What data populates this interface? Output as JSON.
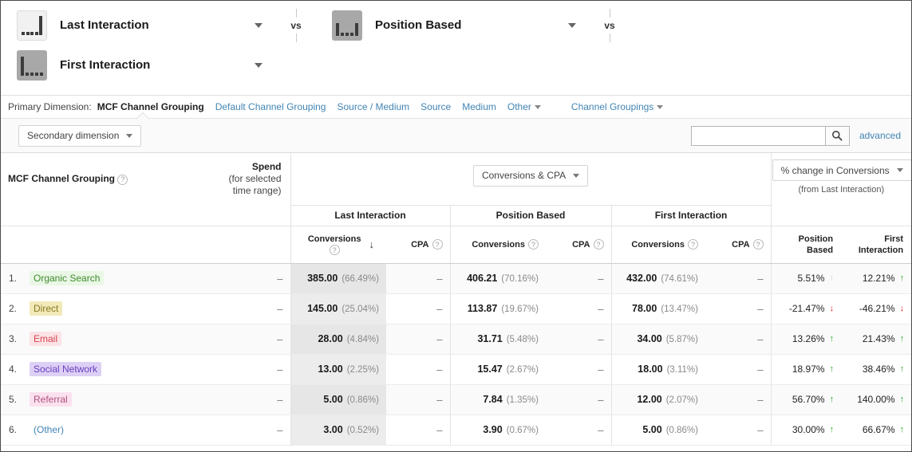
{
  "models": {
    "separator_label": "vs",
    "slots": [
      {
        "name": "Last Interaction",
        "icon": "bars-last-interaction-icon",
        "icon_style": "light",
        "bars": [
          4,
          4,
          4,
          4,
          24
        ]
      },
      {
        "name": "Position Based",
        "icon": "bars-position-based-icon",
        "icon_style": "gray",
        "bars": [
          16,
          4,
          4,
          4,
          16
        ]
      },
      {
        "name": "First Interaction",
        "icon": "bars-first-interaction-icon",
        "icon_style": "gray",
        "bars": [
          24,
          4,
          4,
          4,
          4
        ]
      }
    ]
  },
  "primary_dimension": {
    "label": "Primary Dimension:",
    "items": [
      {
        "label": "MCF Channel Grouping",
        "active": true,
        "caret": false
      },
      {
        "label": "Default Channel Grouping",
        "active": false,
        "caret": false
      },
      {
        "label": "Source / Medium",
        "active": false,
        "caret": false
      },
      {
        "label": "Source",
        "active": false,
        "caret": false
      },
      {
        "label": "Medium",
        "active": false,
        "caret": false
      },
      {
        "label": "Other",
        "active": false,
        "caret": true
      },
      {
        "label": "Channel Groupings",
        "active": false,
        "caret": true
      }
    ]
  },
  "toolbar": {
    "secondary_dimension_label": "Secondary dimension",
    "search_value": "",
    "search_placeholder": "",
    "advanced_label": "advanced",
    "search_icon": "magnifier-icon"
  },
  "table": {
    "dimension_header": "MCF Channel Grouping",
    "spend_header_line1": "Spend",
    "spend_header_line2": "(for selected",
    "spend_header_line3": "time range)",
    "metric_selector": "Conversions & CPA",
    "change_selector": "% change in Conversions",
    "change_sublabel": "(from Last Interaction)",
    "sort_arrow": "↓",
    "help_glyph": "?",
    "model_columns": [
      {
        "name": "Last Interaction",
        "metrics": [
          "Conversions",
          "CPA"
        ],
        "sorted_metric": "Conversions"
      },
      {
        "name": "Position Based",
        "metrics": [
          "Conversions",
          "CPA"
        ],
        "sorted_metric": ""
      },
      {
        "name": "First Interaction",
        "metrics": [
          "Conversions",
          "CPA"
        ],
        "sorted_metric": ""
      }
    ],
    "change_columns": [
      {
        "line1": "Position",
        "line2": "Based"
      },
      {
        "line1": "First",
        "line2": "Interaction"
      }
    ],
    "rows": [
      {
        "index": "1.",
        "channel": "Organic Search",
        "chip_bg": "#eaf7e6",
        "chip_fg": "#3f8a2e",
        "spend": "–",
        "last_conv": "385.00",
        "last_conv_pct": "(66.49%)",
        "last_cpa": "–",
        "pos_conv": "406.21",
        "pos_conv_pct": "(70.16%)",
        "pos_cpa": "–",
        "first_conv": "432.00",
        "first_conv_pct": "(74.61%)",
        "first_cpa": "–",
        "chg_pos": "5.51%",
        "chg_pos_dir": "flat",
        "chg_first": "12.21%",
        "chg_first_dir": "up"
      },
      {
        "index": "2.",
        "channel": "Direct",
        "chip_bg": "#f2e9b8",
        "chip_fg": "#8a7a21",
        "spend": "–",
        "last_conv": "145.00",
        "last_conv_pct": "(25.04%)",
        "last_cpa": "–",
        "pos_conv": "113.87",
        "pos_conv_pct": "(19.67%)",
        "pos_cpa": "–",
        "first_conv": "78.00",
        "first_conv_pct": "(13.47%)",
        "first_cpa": "–",
        "chg_pos": "-21.47%",
        "chg_pos_dir": "down",
        "chg_first": "-46.21%",
        "chg_first_dir": "down"
      },
      {
        "index": "3.",
        "channel": "Email",
        "chip_bg": "#fbe3e6",
        "chip_fg": "#d8434f",
        "spend": "–",
        "last_conv": "28.00",
        "last_conv_pct": "(4.84%)",
        "last_cpa": "–",
        "pos_conv": "31.71",
        "pos_conv_pct": "(5.48%)",
        "pos_cpa": "–",
        "first_conv": "34.00",
        "first_conv_pct": "(5.87%)",
        "first_cpa": "–",
        "chg_pos": "13.26%",
        "chg_pos_dir": "up",
        "chg_first": "21.43%",
        "chg_first_dir": "up"
      },
      {
        "index": "4.",
        "channel": "Social Network",
        "chip_bg": "#ddd0f5",
        "chip_fg": "#6a3fc0",
        "spend": "–",
        "last_conv": "13.00",
        "last_conv_pct": "(2.25%)",
        "last_cpa": "–",
        "pos_conv": "15.47",
        "pos_conv_pct": "(2.67%)",
        "pos_cpa": "–",
        "first_conv": "18.00",
        "first_conv_pct": "(3.11%)",
        "first_cpa": "–",
        "chg_pos": "18.97%",
        "chg_pos_dir": "up",
        "chg_first": "38.46%",
        "chg_first_dir": "up"
      },
      {
        "index": "5.",
        "channel": "Referral",
        "chip_bg": "#fbe1ef",
        "chip_fg": "#b0537f",
        "spend": "–",
        "last_conv": "5.00",
        "last_conv_pct": "(0.86%)",
        "last_cpa": "–",
        "pos_conv": "7.84",
        "pos_conv_pct": "(1.35%)",
        "pos_cpa": "–",
        "first_conv": "12.00",
        "first_conv_pct": "(2.07%)",
        "first_cpa": "–",
        "chg_pos": "56.70%",
        "chg_pos_dir": "up",
        "chg_first": "140.00%",
        "chg_first_dir": "up"
      },
      {
        "index": "6.",
        "channel": "(Other)",
        "chip_bg": "transparent",
        "chip_fg": "#4285b4",
        "spend": "–",
        "last_conv": "3.00",
        "last_conv_pct": "(0.52%)",
        "last_cpa": "–",
        "pos_conv": "3.90",
        "pos_conv_pct": "(0.67%)",
        "pos_cpa": "–",
        "first_conv": "5.00",
        "first_conv_pct": "(0.86%)",
        "first_cpa": "–",
        "chg_pos": "30.00%",
        "chg_pos_dir": "up",
        "chg_first": "66.67%",
        "chg_first_dir": "up"
      }
    ]
  }
}
